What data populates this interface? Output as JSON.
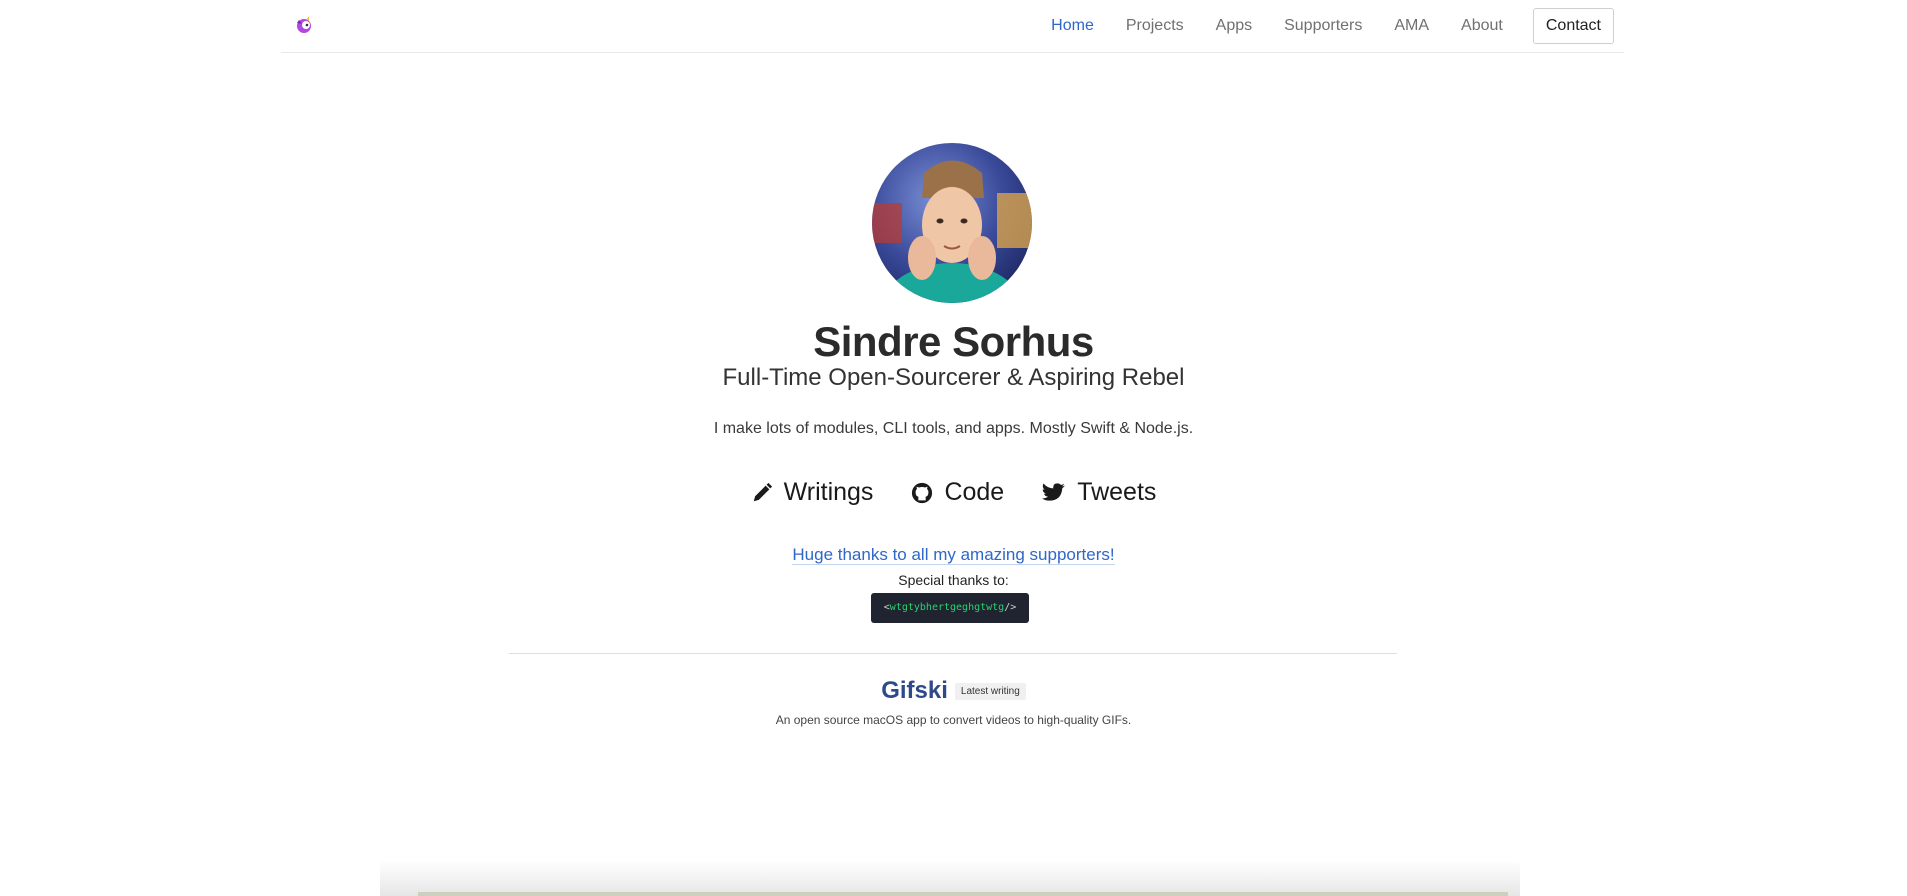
{
  "header": {
    "logo_icon": "unicorn-icon",
    "nav": [
      {
        "label": "Home",
        "active": true
      },
      {
        "label": "Projects",
        "active": false
      },
      {
        "label": "Apps",
        "active": false
      },
      {
        "label": "Supporters",
        "active": false
      },
      {
        "label": "AMA",
        "active": false
      },
      {
        "label": "About",
        "active": false
      }
    ],
    "contact_label": "Contact"
  },
  "profile": {
    "name": "Sindre Sorhus",
    "tagline": "Full-Time Open-Sourcerer & Aspiring Rebel",
    "intro": "I make lots of modules, CLI tools, and apps. Mostly Swift & Node.js."
  },
  "social": [
    {
      "label": "Writings",
      "icon": "pencil-icon"
    },
    {
      "label": "Code",
      "icon": "github-icon"
    },
    {
      "label": "Tweets",
      "icon": "twitter-icon"
    }
  ],
  "supporters": {
    "link_text": "Huge thanks to all my amazing supporters!",
    "special_thanks": "Special thanks to:",
    "sponsor_open": "<",
    "sponsor_name": "wtgtybhertgeghgtwtg",
    "sponsor_close": "/>"
  },
  "latest": {
    "title": "Gifski",
    "badge": "Latest writing",
    "description": "An open source macOS app to convert videos to high-quality GIFs."
  },
  "colors": {
    "accent": "#2f67c9",
    "writing_title": "#2f4a8a",
    "sponsor_bg": "#1f2430",
    "sponsor_green": "#27d36b"
  }
}
